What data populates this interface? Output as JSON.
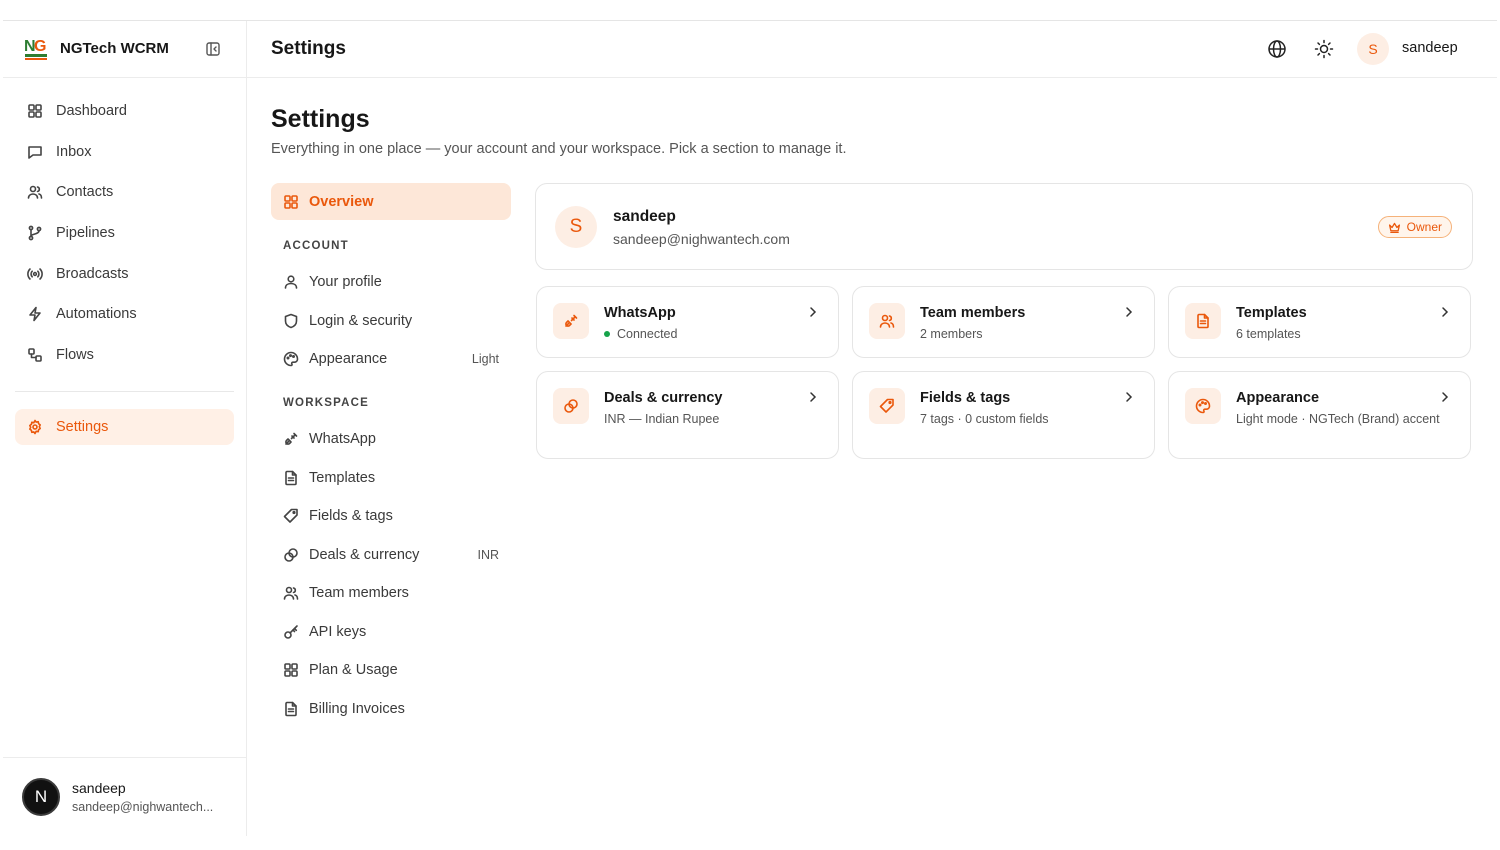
{
  "app": {
    "name": "NGTech WCRM",
    "logo_text": "NG"
  },
  "sidebar": {
    "items": [
      {
        "label": "Dashboard",
        "icon": "grid-icon"
      },
      {
        "label": "Inbox",
        "icon": "message-square-icon"
      },
      {
        "label": "Contacts",
        "icon": "users-icon"
      },
      {
        "label": "Pipelines",
        "icon": "git-branch-icon"
      },
      {
        "label": "Broadcasts",
        "icon": "radio-icon"
      },
      {
        "label": "Automations",
        "icon": "zap-icon"
      },
      {
        "label": "Flows",
        "icon": "workflow-icon"
      }
    ],
    "settings_label": "Settings",
    "user": {
      "initial": "N",
      "name": "sandeep",
      "email": "sandeep@nighwantech..."
    }
  },
  "header": {
    "title": "Settings",
    "user_initial": "S",
    "username": "sandeep"
  },
  "page": {
    "title": "Settings",
    "subtitle": "Everything in one place — your account and your workspace. Pick a section to manage it."
  },
  "subnav": {
    "overview_label": "Overview",
    "account_heading": "ACCOUNT",
    "account_items": [
      {
        "label": "Your profile",
        "icon": "user-icon",
        "meta": ""
      },
      {
        "label": "Login & security",
        "icon": "shield-icon",
        "meta": ""
      },
      {
        "label": "Appearance",
        "icon": "palette-icon",
        "meta": "Light"
      }
    ],
    "workspace_heading": "WORKSPACE",
    "workspace_items": [
      {
        "label": "WhatsApp",
        "icon": "plug-icon",
        "meta": ""
      },
      {
        "label": "Templates",
        "icon": "file-text-icon",
        "meta": ""
      },
      {
        "label": "Fields & tags",
        "icon": "tag-icon",
        "meta": ""
      },
      {
        "label": "Deals & currency",
        "icon": "coins-icon",
        "meta": "INR"
      },
      {
        "label": "Team members",
        "icon": "users-icon",
        "meta": ""
      },
      {
        "label": "API keys",
        "icon": "key-icon",
        "meta": ""
      },
      {
        "label": "Plan & Usage",
        "icon": "grid-icon",
        "meta": ""
      },
      {
        "label": "Billing Invoices",
        "icon": "file-text-icon",
        "meta": ""
      }
    ]
  },
  "profile": {
    "initial": "S",
    "name": "sandeep",
    "email": "sandeep@nighwantech.com",
    "role": "Owner"
  },
  "cards": [
    {
      "title": "WhatsApp",
      "subtitle": "Connected",
      "icon": "plug-icon",
      "status": "connected"
    },
    {
      "title": "Team members",
      "subtitle": "2 members",
      "icon": "users-icon"
    },
    {
      "title": "Templates",
      "subtitle": "6 templates",
      "icon": "file-text-icon"
    },
    {
      "title": "Deals & currency",
      "subtitle": "INR — Indian Rupee",
      "icon": "coins-icon"
    },
    {
      "title": "Fields & tags",
      "subtitle": "7 tags · 0 custom fields",
      "icon": "tag-icon"
    },
    {
      "title": "Appearance",
      "subtitle": "Light mode · NGTech (Brand) accent",
      "icon": "palette-icon"
    }
  ],
  "colors": {
    "accent": "#ea580c",
    "accent_bg": "#fdeee4",
    "status_connected": "#16a34a"
  }
}
